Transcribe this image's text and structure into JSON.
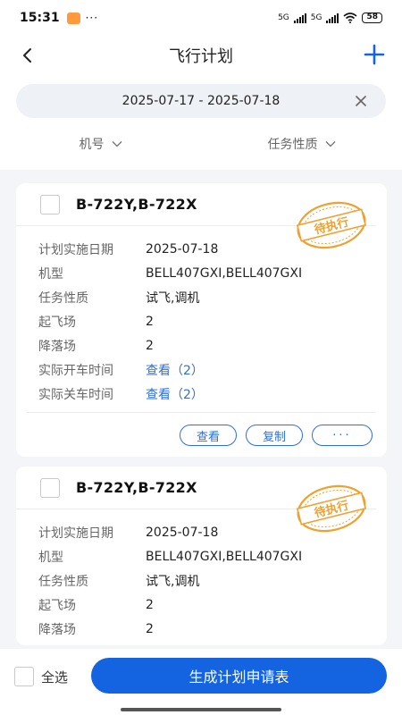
{
  "status_bar": {
    "time": "15:31",
    "dots": "···",
    "net1": "5G",
    "net2": "5G",
    "battery": "58"
  },
  "nav": {
    "title": "飞行计划",
    "back_icon": "chevron-left-icon",
    "add_icon": "plus-icon"
  },
  "filter": {
    "date_range": "2025-07-17 - 2025-07-18",
    "tabs": [
      {
        "label": "机号"
      },
      {
        "label": "任务性质"
      }
    ]
  },
  "cards": [
    {
      "title": "B-722Y,B-722X",
      "stamp": "待执行",
      "rows": [
        {
          "label": "计划实施日期",
          "value": "2025-07-18"
        },
        {
          "label": "机型",
          "value": "BELL407GXI,BELL407GXI"
        },
        {
          "label": "任务性质",
          "value": "试飞,调机"
        },
        {
          "label": "起飞场",
          "value": "2"
        },
        {
          "label": "降落场",
          "value": "2"
        },
        {
          "label": "实际开车时间",
          "value": "查看（2）"
        },
        {
          "label": "实际关车时间",
          "value": "查看（2）"
        }
      ],
      "actions": {
        "view": "查看",
        "copy": "复制",
        "more": "···"
      }
    },
    {
      "title": "B-722Y,B-722X",
      "stamp": "待执行",
      "rows": [
        {
          "label": "计划实施日期",
          "value": "2025-07-18"
        },
        {
          "label": "机型",
          "value": "BELL407GXI,BELL407GXI"
        },
        {
          "label": "任务性质",
          "value": "试飞,调机"
        },
        {
          "label": "起飞场",
          "value": "2"
        },
        {
          "label": "降落场",
          "value": "2"
        }
      ]
    }
  ],
  "bottom": {
    "select_all": "全选",
    "generate": "生成计划申请表"
  },
  "colors": {
    "accent": "#1463e0",
    "link": "#2f6fd6",
    "stamp": "#f0a030"
  }
}
